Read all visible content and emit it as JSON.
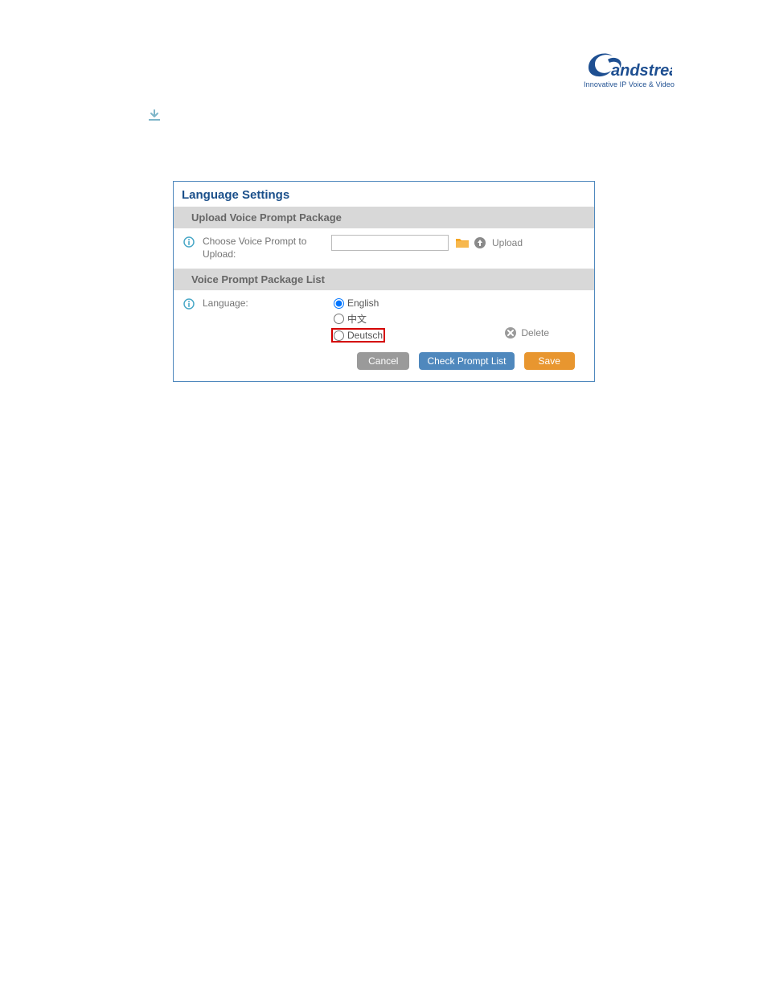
{
  "logo": {
    "brand_end": "andstream",
    "tagline": "Innovative IP Voice & Video"
  },
  "panel": {
    "title": "Language Settings",
    "upload_section": {
      "header": "Upload Voice Prompt Package",
      "label_line1": "Choose Voice Prompt to",
      "label_line2": "Upload:",
      "upload_label": "Upload",
      "file_value": ""
    },
    "list_section": {
      "header": "Voice Prompt Package List",
      "label": "Language:",
      "delete_label": "Delete",
      "languages": {
        "english": "English",
        "chinese": "中文",
        "deutsch": "Deutsch"
      }
    },
    "buttons": {
      "cancel": "Cancel",
      "check": "Check Prompt List",
      "save": "Save"
    }
  }
}
